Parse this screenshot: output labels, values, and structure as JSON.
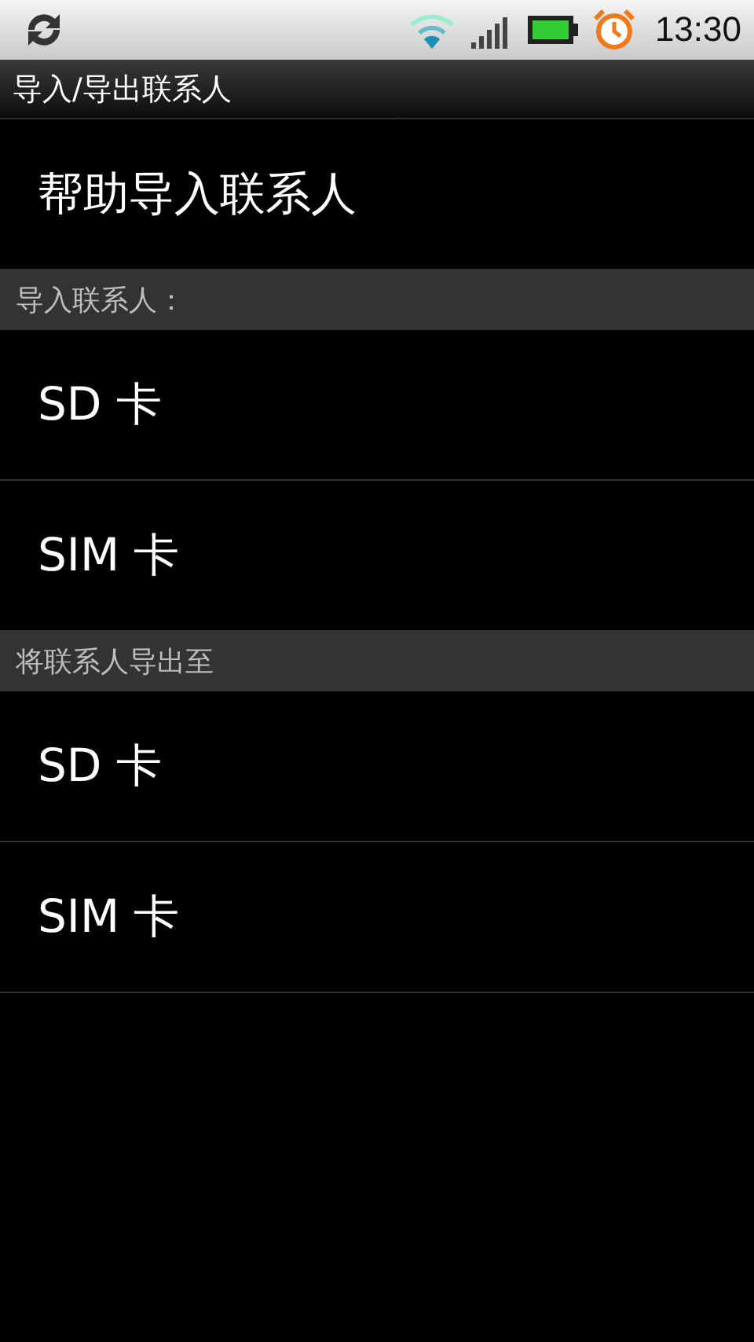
{
  "status_bar": {
    "time": "13:30"
  },
  "window": {
    "title": "导入/导出联系人"
  },
  "sections": [
    {
      "items": [
        {
          "label": "帮助导入联系人"
        }
      ]
    },
    {
      "header": "导入联系人：",
      "items": [
        {
          "label": "SD 卡"
        },
        {
          "label": "SIM 卡"
        }
      ]
    },
    {
      "header": "将联系人导出至",
      "items": [
        {
          "label": "SD 卡"
        },
        {
          "label": "SIM 卡"
        }
      ]
    }
  ]
}
